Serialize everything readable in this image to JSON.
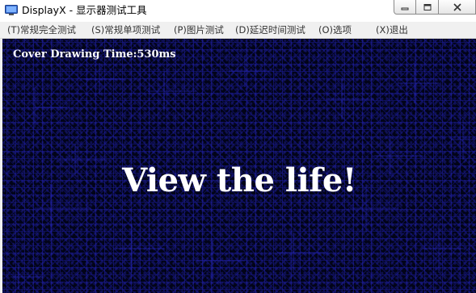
{
  "window": {
    "title": "DisplayX - 显示器测试工具",
    "app_icon": "monitor-icon",
    "controls": [
      "minimize-icon",
      "maximize-icon",
      "close-icon"
    ]
  },
  "menu": {
    "items": [
      {
        "label": "(T)常规完全测试"
      },
      {
        "label": "(S)常规单项测试"
      },
      {
        "label": "(P)图片测试"
      },
      {
        "label": "(D)延迟时间测试"
      },
      {
        "label": "(O)选项"
      },
      {
        "label": "(X)退出"
      }
    ]
  },
  "canvas": {
    "cover_time": "Cover Drawing Time:530ms",
    "headline": "View the life!"
  },
  "colors": {
    "canvas_background": "#020418",
    "pattern_blue": "#2323b4",
    "text": "#ffffff",
    "menu_background": "#f0f0f0"
  }
}
